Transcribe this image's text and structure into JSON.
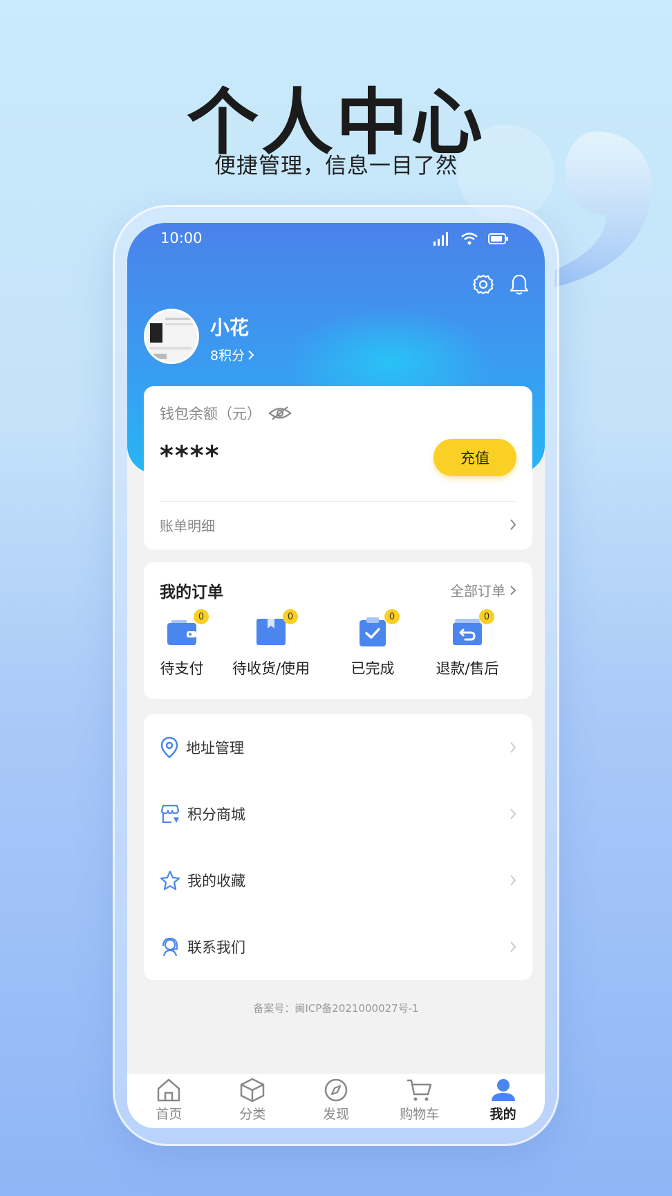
{
  "hero": {
    "title": "个人中心",
    "subtitle": "便捷管理，信息一目了然"
  },
  "status_bar": {
    "time": "10:00"
  },
  "header": {
    "icons": [
      "settings-icon",
      "bell-icon"
    ],
    "username": "小花",
    "points": "8积分"
  },
  "wallet": {
    "label": "钱包余额（元）",
    "amount": "****",
    "recharge_label": "充值",
    "bill_label": "账单明细"
  },
  "orders": {
    "title": "我的订单",
    "all_label": "全部订单",
    "items": [
      {
        "label": "待支付",
        "count": "0",
        "icon": "wallet-icon"
      },
      {
        "label": "待收货/使用",
        "count": "0",
        "icon": "box-icon"
      },
      {
        "label": "已完成",
        "count": "0",
        "icon": "clipboard-check-icon"
      },
      {
        "label": "退款/售后",
        "count": "0",
        "icon": "return-box-icon"
      }
    ]
  },
  "menu": {
    "items": [
      {
        "label": "地址管理",
        "icon": "location-pin-icon"
      },
      {
        "label": "积分商城",
        "icon": "store-icon"
      },
      {
        "label": "我的收藏",
        "icon": "star-icon"
      },
      {
        "label": "联系我们",
        "icon": "customer-service-icon"
      }
    ]
  },
  "icp": "备案号：闽ICP备2021000027号-1",
  "tabbar": {
    "active": "我的",
    "items": [
      {
        "label": "首页",
        "icon": "home-icon"
      },
      {
        "label": "分类",
        "icon": "cube-icon"
      },
      {
        "label": "发现",
        "icon": "compass-icon"
      },
      {
        "label": "购物车",
        "icon": "cart-icon"
      },
      {
        "label": "我的",
        "icon": "user-icon"
      }
    ]
  },
  "colors": {
    "accent_blue": "#4b82ea",
    "recharge_yellow": "#fbd026",
    "icon_blue": "#4a86ee"
  }
}
